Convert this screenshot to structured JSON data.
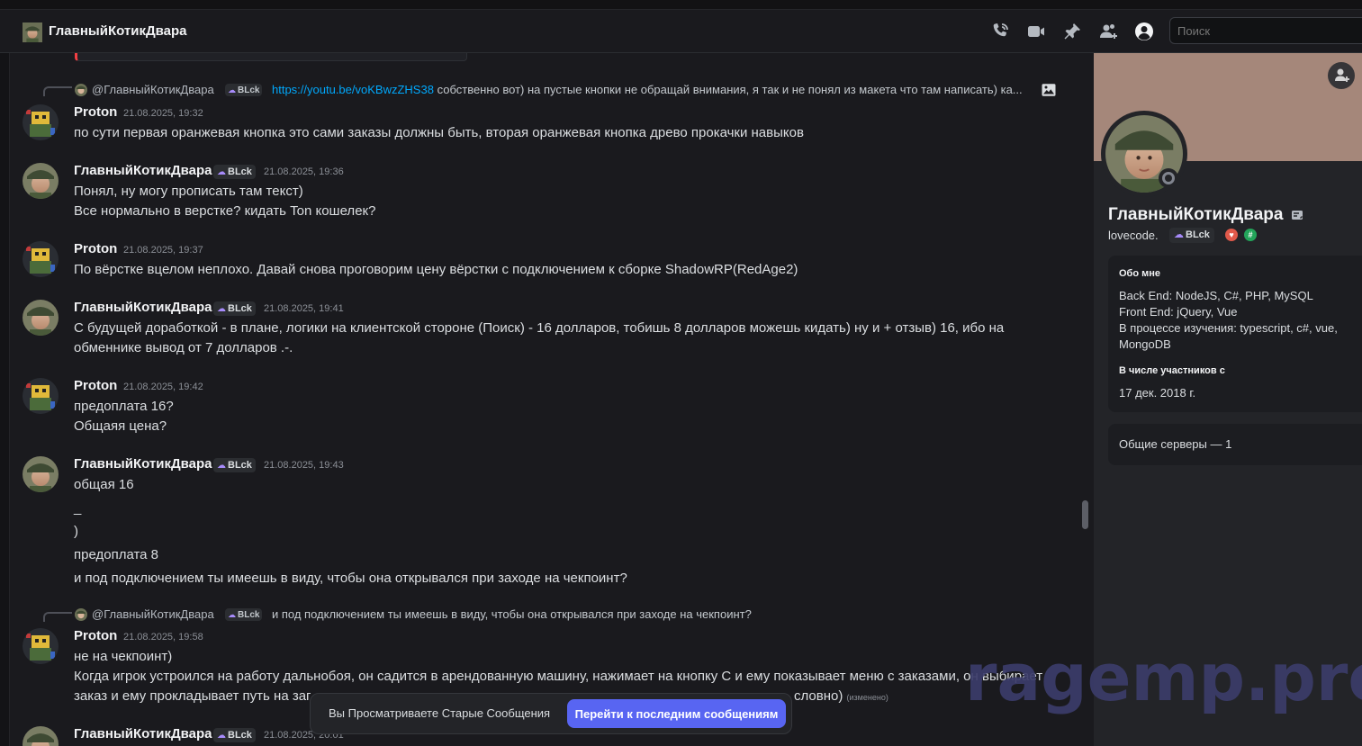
{
  "channel": {
    "title": "ГлавныйКотикДвара"
  },
  "search": {
    "placeholder": "Поиск"
  },
  "icons": [
    "phone-icon",
    "video-icon",
    "pin-icon",
    "add-members-icon",
    "profile-icon",
    "image-icon",
    "add-friend-icon"
  ],
  "colors": {
    "accent": "#5865f2",
    "link": "#00a8fc",
    "watermark": "#3b3c6a"
  },
  "users": {
    "proton": "Proton",
    "kotik": "ГлавныйКотикДвара"
  },
  "role_tag": "BLck",
  "reply1": {
    "name": "@ГлавныйКотикДвара",
    "link": "https://youtu.be/voKBwzZHS38",
    "text": "собственно вот) на пустые кнопки не обращай внимания, я так и не понял из макета что там написать) ка..."
  },
  "messages": [
    {
      "author": "Proton",
      "time": "21.08.2025, 19:32",
      "lines": [
        "по сути первая оранжевая кнопка это сами заказы должны быть, вторая оранжевая кнопка древо прокачки навыков"
      ]
    },
    {
      "author": "ГлавныйКотикДвара",
      "time": "21.08.2025, 19:36",
      "lines": [
        "Понял, ну могу прописать там текст)",
        "Все нормально в верстке? кидать Ton кошелек?"
      ]
    },
    {
      "author": "Proton",
      "time": "21.08.2025, 19:37",
      "lines": [
        "По вёрстке вцелом неплохо. Давай снова проговорим цену вёрстки с подключением к сборке ShadowRP(RedAge2)"
      ]
    },
    {
      "author": "ГлавныйКотикДвара",
      "time": "21.08.2025, 19:41",
      "lines": [
        "С будущей доработкой -  в плане, логики на клиентской стороне (Поиск) - 16 долларов, тобишь 8 долларов можешь кидать) ну и + отзыв) 16, ибо на",
        "обменнике вывод от 7 долларов .-."
      ]
    },
    {
      "author": "Proton",
      "time": "21.08.2025, 19:42",
      "lines": [
        "предоплата 16?",
        "Общаяя цена?"
      ]
    },
    {
      "author": "ГлавныйКотикДвара",
      "time": "21.08.2025, 19:43",
      "lines": [
        "общая 16",
        "_",
        ")",
        "предоплата 8",
        "и под подключением ты имеешь в виду, чтобы она открывался при заходе на чекпоинт?"
      ]
    },
    {
      "author": "Proton",
      "time": "21.08.2025, 19:58",
      "lines": [
        "не на чекпоинт)",
        "Когда игрок устроился на работу дальнобоя, он садится в арендованную машину, нажимает на кнопку C и ему показывает меню с заказами, он выбирает",
        "заказ и ему прокладывает путь на заг",
        "словно)"
      ],
      "edited": "(изменено)"
    },
    {
      "author": "ГлавныйКотикДвара",
      "time": "21.08.2025, 20:01",
      "lines": []
    }
  ],
  "reply2": {
    "name": "@ГлавныйКотикДвара",
    "text": "и под подключением ты имеешь в виду, чтобы она открывался при заходе на чекпоинт?"
  },
  "toast": {
    "text": "Вы Просматриваете Старые Сообщения",
    "button": "Перейти к последним сообщениям"
  },
  "watermark": "ragemp.pro",
  "profile": {
    "name": "ГлавныйКотикДвара",
    "username": "lovecode.",
    "tag": "BLck",
    "about_title": "Обо мне",
    "about_lines": [
      "Back End: NodeJS, C#, PHP, MySQL",
      "Front End: jQuery, Vue",
      "В процессе изучения: typescript, c#, vue,",
      "MongoDB"
    ],
    "member_title": "В числе участников с",
    "member_since": "17 дек. 2018 г.",
    "mutual": "Общие серверы — 1"
  }
}
